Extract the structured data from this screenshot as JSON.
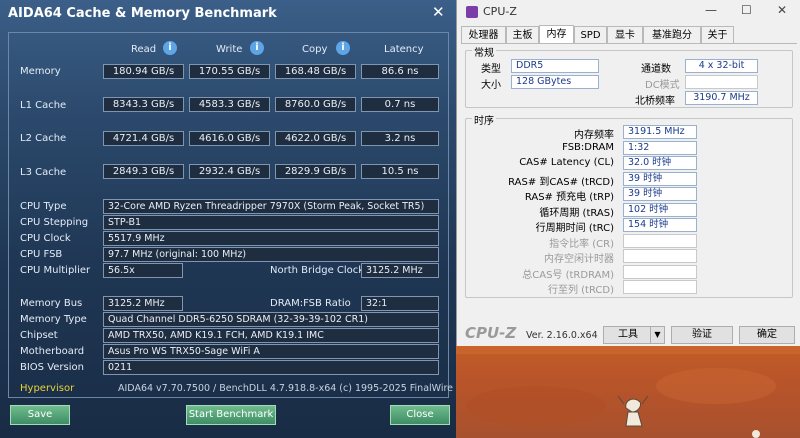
{
  "aida": {
    "title": "AIDA64 Cache & Memory Benchmark",
    "columns": [
      "Read",
      "Write",
      "Copy",
      "Latency"
    ],
    "rows": [
      {
        "label": "Memory",
        "read": "180.94 GB/s",
        "write": "170.55 GB/s",
        "copy": "168.48 GB/s",
        "latency": "86.6 ns"
      },
      {
        "label": "L1 Cache",
        "read": "8343.3 GB/s",
        "write": "4583.3 GB/s",
        "copy": "8760.0 GB/s",
        "latency": "0.7 ns"
      },
      {
        "label": "L2 Cache",
        "read": "4721.4 GB/s",
        "write": "4616.0 GB/s",
        "copy": "4622.0 GB/s",
        "latency": "3.2 ns"
      },
      {
        "label": "L3 Cache",
        "read": "2849.3 GB/s",
        "write": "2932.4 GB/s",
        "copy": "2829.9 GB/s",
        "latency": "10.5 ns"
      }
    ],
    "cpu_type_label": "CPU Type",
    "cpu_type": "32-Core AMD Ryzen Threadripper 7970X  (Storm Peak, Socket TR5)",
    "cpu_stepping_label": "CPU Stepping",
    "cpu_stepping": "STP-B1",
    "cpu_clock_label": "CPU Clock",
    "cpu_clock": "5517.9 MHz",
    "cpu_fsb_label": "CPU FSB",
    "cpu_fsb": "97.7 MHz  (original: 100 MHz)",
    "cpu_multiplier_label": "CPU Multiplier",
    "cpu_multiplier": "56.5x",
    "nb_clock_label": "North Bridge Clock",
    "nb_clock": "3125.2 MHz",
    "memory_bus_label": "Memory Bus",
    "memory_bus": "3125.2 MHz",
    "dram_fsb_label": "DRAM:FSB Ratio",
    "dram_fsb": "32:1",
    "memory_type_label": "Memory Type",
    "memory_type": "Quad Channel DDR5-6250 SDRAM  (32-39-39-102 CR1)",
    "chipset_label": "Chipset",
    "chipset": "AMD TRX50, AMD K19.1 FCH, AMD K19.1 IMC",
    "motherboard_label": "Motherboard",
    "motherboard": "Asus Pro WS TRX50-Sage WiFi A",
    "bios_label": "BIOS Version",
    "bios": "0211",
    "hypervisor": "Hypervisor",
    "footer": "AIDA64 v7.70.7500 / BenchDLL 4.7.918.8-x64  (c) 1995-2025 FinalWire Ltd.",
    "save": "Save",
    "start": "Start Benchmark",
    "close": "Close",
    "close_x": "✕"
  },
  "cpuz": {
    "title": "CPU-Z",
    "minimize": "—",
    "maximize": "☐",
    "close": "✕",
    "tabs": [
      "处理器",
      "主板",
      "内存",
      "SPD",
      "显卡",
      "基准跑分",
      "关于"
    ],
    "active_tab": "内存",
    "general": {
      "title": "常规",
      "type_label": "类型",
      "type": "DDR5",
      "size_label": "大小",
      "size": "128 GBytes",
      "channels_label": "通道数",
      "channels": "4 x 32-bit",
      "dc_label": "DC模式",
      "dc": "",
      "nb_label": "北桥频率",
      "nb": "3190.7 MHz"
    },
    "timings": {
      "title": "时序",
      "rows": [
        {
          "label": "内存频率",
          "value": "3191.5 MHz",
          "enabled": true
        },
        {
          "label": "FSB:DRAM",
          "value": "1:32",
          "enabled": true
        },
        {
          "label": "CAS# Latency (CL)",
          "value": "32.0 时钟",
          "enabled": true
        },
        {
          "label": "RAS# 到CAS# (tRCD)",
          "value": "39 时钟",
          "enabled": true
        },
        {
          "label": "RAS# 预充电 (tRP)",
          "value": "39 时钟",
          "enabled": true
        },
        {
          "label": "循环周期 (tRAS)",
          "value": "102 时钟",
          "enabled": true
        },
        {
          "label": "行周期时间 (tRC)",
          "value": "154 时钟",
          "enabled": true
        },
        {
          "label": "指令比率 (CR)",
          "value": "",
          "enabled": false
        },
        {
          "label": "内存空闲计时器",
          "value": "",
          "enabled": false
        },
        {
          "label": "总CAS号 (tRDRAM)",
          "value": "",
          "enabled": false
        },
        {
          "label": "行至列 (tRCD)",
          "value": "",
          "enabled": false
        }
      ]
    },
    "brand": "CPU-Z",
    "version": "Ver. 2.16.0.x64",
    "tools": "工具",
    "validate": "验证",
    "ok": "确定"
  }
}
